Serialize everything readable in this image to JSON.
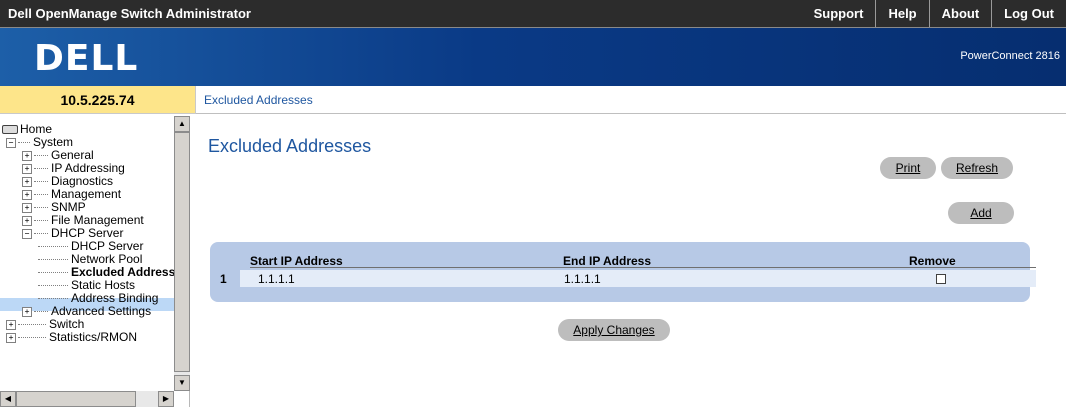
{
  "app": {
    "title": "Dell OpenManage Switch Administrator"
  },
  "toplinks": [
    "Support",
    "Help",
    "About",
    "Log Out"
  ],
  "banner": {
    "logo": "DELL",
    "product": "PowerConnect 2816"
  },
  "device_ip": "10.5.225.74",
  "breadcrumb": "Excluded Addresses",
  "tree": [
    {
      "label": "Home",
      "expander": "",
      "icon": "computer-icon"
    },
    {
      "label": "System",
      "expander": "⊟"
    },
    {
      "label": "General",
      "expander": "⊞"
    },
    {
      "label": "IP Addressing",
      "expander": "⊞"
    },
    {
      "label": "Diagnostics",
      "expander": "⊞"
    },
    {
      "label": "Management",
      "expander": "⊞"
    },
    {
      "label": "SNMP",
      "expander": "⊞"
    },
    {
      "label": "File Management",
      "expander": "⊞"
    },
    {
      "label": "DHCP Server",
      "expander": "⊟"
    },
    {
      "label": "DHCP Server",
      "expander": ""
    },
    {
      "label": "Network Pool",
      "expander": ""
    },
    {
      "label": "Excluded Addresses",
      "expander": "",
      "selected": true
    },
    {
      "label": "Static Hosts",
      "expander": ""
    },
    {
      "label": "Address Binding",
      "expander": ""
    },
    {
      "label": "Advanced Settings",
      "expander": "⊞"
    },
    {
      "label": "Switch",
      "expander": "⊞"
    },
    {
      "label": "Statistics/RMON",
      "expander": "⊞"
    }
  ],
  "main": {
    "title": "Excluded Addresses",
    "print_label": "Print",
    "refresh_label": "Refresh",
    "add_label": "Add",
    "apply_label": "Apply Changes"
  },
  "table": {
    "headers": {
      "start": "Start IP Address",
      "end": "End IP Address",
      "remove": "Remove"
    },
    "rows": [
      {
        "num": "1",
        "start": "1.1.1.1",
        "end": "1.1.1.1",
        "remove": false
      }
    ]
  },
  "colors": {
    "accent": "#1f57a0",
    "banner": "#0a3a86",
    "ip_box": "#fde58a",
    "table_frame": "#b7c9e6"
  }
}
